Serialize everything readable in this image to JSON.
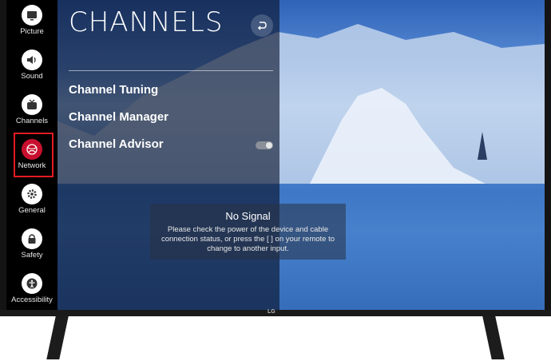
{
  "panel": {
    "title": "CHANNELS",
    "back_icon": "back-arrow-icon"
  },
  "sidebar": {
    "items": [
      {
        "label": "Picture",
        "icon": "picture-icon"
      },
      {
        "label": "Sound",
        "icon": "sound-icon"
      },
      {
        "label": "Channels",
        "icon": "channels-icon"
      },
      {
        "label": "Network",
        "icon": "network-icon",
        "selected": true
      },
      {
        "label": "General",
        "icon": "gear-icon"
      },
      {
        "label": "Safety",
        "icon": "lock-icon"
      },
      {
        "label": "Accessibility",
        "icon": "accessibility-icon"
      }
    ]
  },
  "menu": {
    "items": [
      {
        "label": "Channel Tuning"
      },
      {
        "label": "Channel Manager"
      },
      {
        "label": "Channel Advisor",
        "toggle": "on"
      }
    ]
  },
  "no_signal": {
    "title": "No Signal",
    "message": "Please check the power of the device and cable connection status, or press the [ ] on your remote to change to another input."
  },
  "brand": {
    "logo": "LG"
  },
  "colors": {
    "accent": "#c8102e",
    "highlight_border": "#e31b23"
  }
}
